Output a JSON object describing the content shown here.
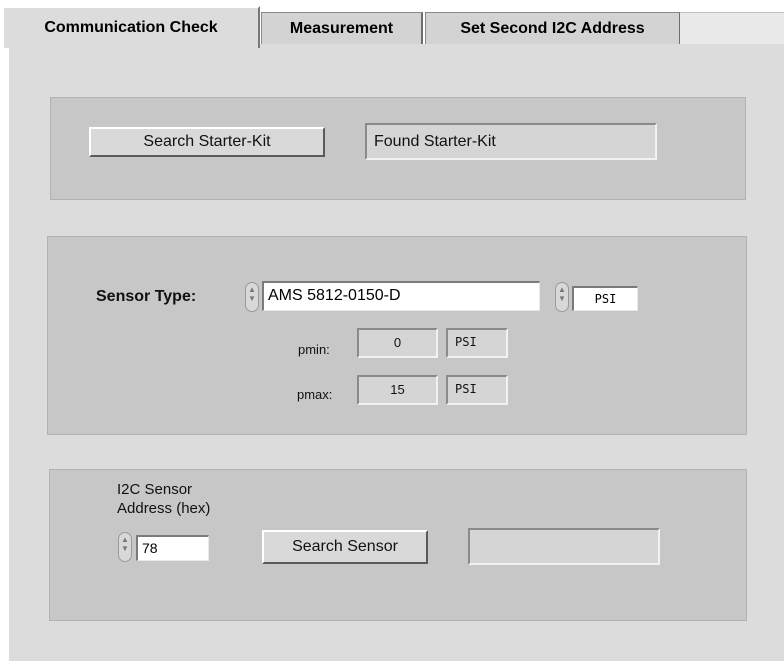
{
  "tabs": [
    {
      "label": "Communication Check",
      "active": true
    },
    {
      "label": "Measurement",
      "active": false
    },
    {
      "label": "Set Second I2C Address",
      "active": false
    }
  ],
  "starter_kit": {
    "search_label": "Search Starter-Kit",
    "status": "Found Starter-Kit"
  },
  "sensor": {
    "type_label": "Sensor Type:",
    "type_value": "AMS 5812-0150-D",
    "unit_value": "PSI",
    "pmin_label": "pmin:",
    "pmin_value": "0",
    "pmin_unit": "PSI",
    "pmax_label": "pmax:",
    "pmax_value": "15",
    "pmax_unit": "PSI"
  },
  "i2c": {
    "address_label_line1": "I2C Sensor",
    "address_label_line2": "Address (hex)",
    "address_value": "78",
    "search_label": "Search Sensor",
    "status": ""
  }
}
